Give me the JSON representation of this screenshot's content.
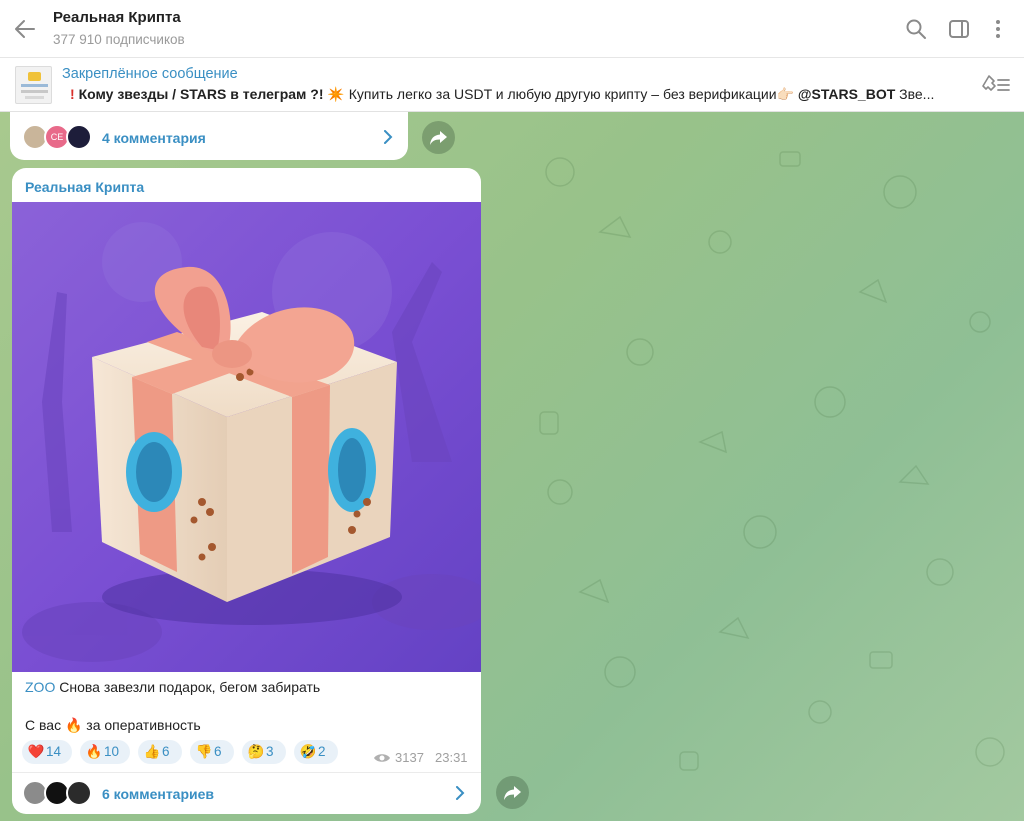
{
  "header": {
    "title": "Реальная Крипта",
    "subscribers": "377 910 подписчиков"
  },
  "pinned": {
    "title": "Закреплённое сообщение",
    "text_bold": "Кому звезды / STARS в телеграм ?!",
    "text_rest": "Купить легко за USDT и любую другую крипту – без верификации",
    "text_handle": "@STARS_BOT",
    "text_tail": "Зве..."
  },
  "prev_message": {
    "comments": "4 комментария",
    "avatar_label": "CE"
  },
  "message": {
    "author": "Реальная Крипта",
    "link": "ZOO",
    "line1": "Снова завезли подарок, бегом забирать",
    "line2_start": "С вас",
    "line2_end": "за оперативность",
    "views": "3137",
    "time": "23:31",
    "comments": "6 комментариев",
    "reactions": [
      {
        "emoji": "❤️",
        "count": "14"
      },
      {
        "emoji": "🔥",
        "count": "10"
      },
      {
        "emoji": "👍",
        "count": "6"
      },
      {
        "emoji": "👎",
        "count": "6"
      },
      {
        "emoji": "🤔",
        "count": "3"
      },
      {
        "emoji": "🤣",
        "count": "2"
      }
    ]
  },
  "colors": {
    "accent": "#3a8fc3",
    "chat_bg": "#9fc28a",
    "image_bg": "#7c4fd0"
  }
}
